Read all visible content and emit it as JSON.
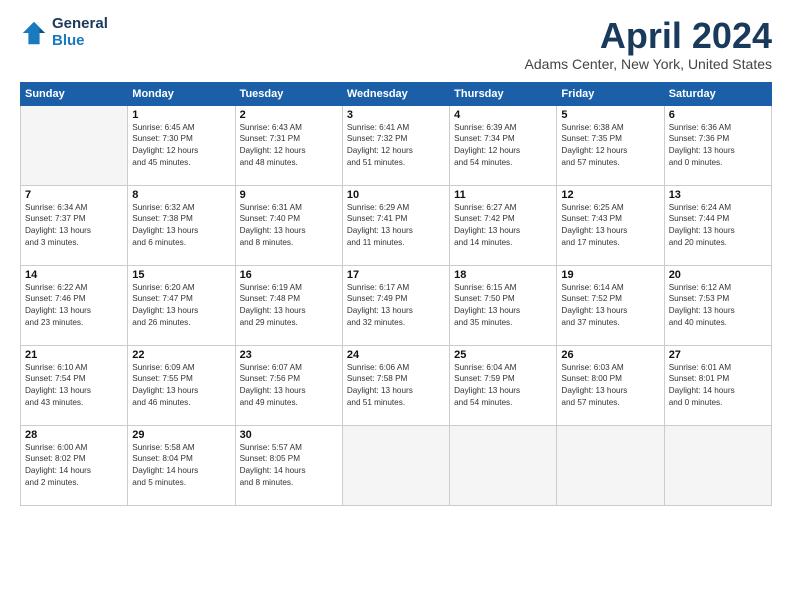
{
  "logo": {
    "line1": "General",
    "line2": "Blue"
  },
  "title": "April 2024",
  "subtitle": "Adams Center, New York, United States",
  "days_of_week": [
    "Sunday",
    "Monday",
    "Tuesday",
    "Wednesday",
    "Thursday",
    "Friday",
    "Saturday"
  ],
  "weeks": [
    [
      {
        "num": "",
        "info": ""
      },
      {
        "num": "1",
        "info": "Sunrise: 6:45 AM\nSunset: 7:30 PM\nDaylight: 12 hours\nand 45 minutes."
      },
      {
        "num": "2",
        "info": "Sunrise: 6:43 AM\nSunset: 7:31 PM\nDaylight: 12 hours\nand 48 minutes."
      },
      {
        "num": "3",
        "info": "Sunrise: 6:41 AM\nSunset: 7:32 PM\nDaylight: 12 hours\nand 51 minutes."
      },
      {
        "num": "4",
        "info": "Sunrise: 6:39 AM\nSunset: 7:34 PM\nDaylight: 12 hours\nand 54 minutes."
      },
      {
        "num": "5",
        "info": "Sunrise: 6:38 AM\nSunset: 7:35 PM\nDaylight: 12 hours\nand 57 minutes."
      },
      {
        "num": "6",
        "info": "Sunrise: 6:36 AM\nSunset: 7:36 PM\nDaylight: 13 hours\nand 0 minutes."
      }
    ],
    [
      {
        "num": "7",
        "info": "Sunrise: 6:34 AM\nSunset: 7:37 PM\nDaylight: 13 hours\nand 3 minutes."
      },
      {
        "num": "8",
        "info": "Sunrise: 6:32 AM\nSunset: 7:38 PM\nDaylight: 13 hours\nand 6 minutes."
      },
      {
        "num": "9",
        "info": "Sunrise: 6:31 AM\nSunset: 7:40 PM\nDaylight: 13 hours\nand 8 minutes."
      },
      {
        "num": "10",
        "info": "Sunrise: 6:29 AM\nSunset: 7:41 PM\nDaylight: 13 hours\nand 11 minutes."
      },
      {
        "num": "11",
        "info": "Sunrise: 6:27 AM\nSunset: 7:42 PM\nDaylight: 13 hours\nand 14 minutes."
      },
      {
        "num": "12",
        "info": "Sunrise: 6:25 AM\nSunset: 7:43 PM\nDaylight: 13 hours\nand 17 minutes."
      },
      {
        "num": "13",
        "info": "Sunrise: 6:24 AM\nSunset: 7:44 PM\nDaylight: 13 hours\nand 20 minutes."
      }
    ],
    [
      {
        "num": "14",
        "info": "Sunrise: 6:22 AM\nSunset: 7:46 PM\nDaylight: 13 hours\nand 23 minutes."
      },
      {
        "num": "15",
        "info": "Sunrise: 6:20 AM\nSunset: 7:47 PM\nDaylight: 13 hours\nand 26 minutes."
      },
      {
        "num": "16",
        "info": "Sunrise: 6:19 AM\nSunset: 7:48 PM\nDaylight: 13 hours\nand 29 minutes."
      },
      {
        "num": "17",
        "info": "Sunrise: 6:17 AM\nSunset: 7:49 PM\nDaylight: 13 hours\nand 32 minutes."
      },
      {
        "num": "18",
        "info": "Sunrise: 6:15 AM\nSunset: 7:50 PM\nDaylight: 13 hours\nand 35 minutes."
      },
      {
        "num": "19",
        "info": "Sunrise: 6:14 AM\nSunset: 7:52 PM\nDaylight: 13 hours\nand 37 minutes."
      },
      {
        "num": "20",
        "info": "Sunrise: 6:12 AM\nSunset: 7:53 PM\nDaylight: 13 hours\nand 40 minutes."
      }
    ],
    [
      {
        "num": "21",
        "info": "Sunrise: 6:10 AM\nSunset: 7:54 PM\nDaylight: 13 hours\nand 43 minutes."
      },
      {
        "num": "22",
        "info": "Sunrise: 6:09 AM\nSunset: 7:55 PM\nDaylight: 13 hours\nand 46 minutes."
      },
      {
        "num": "23",
        "info": "Sunrise: 6:07 AM\nSunset: 7:56 PM\nDaylight: 13 hours\nand 49 minutes."
      },
      {
        "num": "24",
        "info": "Sunrise: 6:06 AM\nSunset: 7:58 PM\nDaylight: 13 hours\nand 51 minutes."
      },
      {
        "num": "25",
        "info": "Sunrise: 6:04 AM\nSunset: 7:59 PM\nDaylight: 13 hours\nand 54 minutes."
      },
      {
        "num": "26",
        "info": "Sunrise: 6:03 AM\nSunset: 8:00 PM\nDaylight: 13 hours\nand 57 minutes."
      },
      {
        "num": "27",
        "info": "Sunrise: 6:01 AM\nSunset: 8:01 PM\nDaylight: 14 hours\nand 0 minutes."
      }
    ],
    [
      {
        "num": "28",
        "info": "Sunrise: 6:00 AM\nSunset: 8:02 PM\nDaylight: 14 hours\nand 2 minutes."
      },
      {
        "num": "29",
        "info": "Sunrise: 5:58 AM\nSunset: 8:04 PM\nDaylight: 14 hours\nand 5 minutes."
      },
      {
        "num": "30",
        "info": "Sunrise: 5:57 AM\nSunset: 8:05 PM\nDaylight: 14 hours\nand 8 minutes."
      },
      {
        "num": "",
        "info": ""
      },
      {
        "num": "",
        "info": ""
      },
      {
        "num": "",
        "info": ""
      },
      {
        "num": "",
        "info": ""
      }
    ]
  ]
}
